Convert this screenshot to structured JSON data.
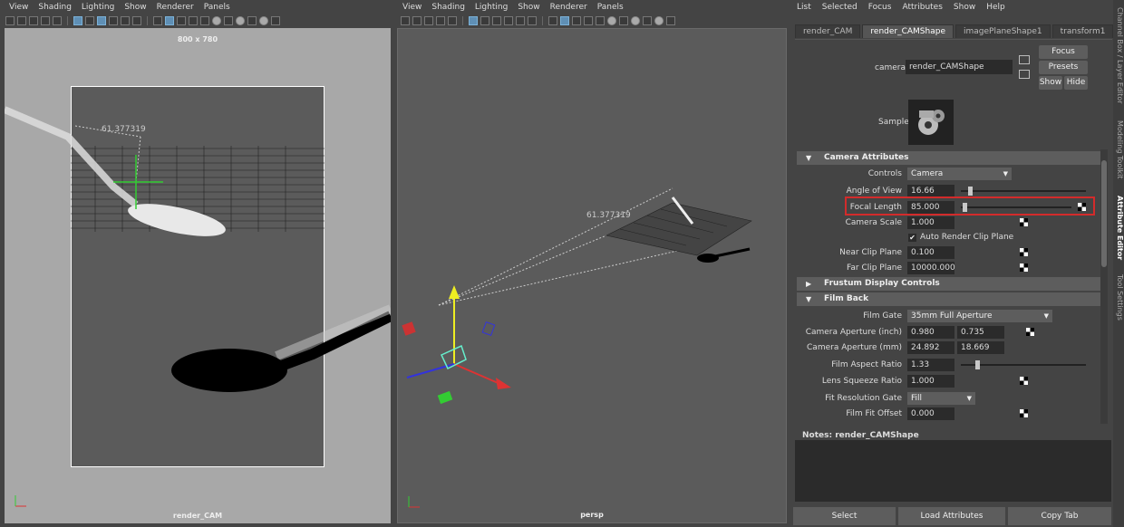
{
  "viewport_left": {
    "menu": [
      "View",
      "Shading",
      "Lighting",
      "Show",
      "Renderer",
      "Panels"
    ],
    "resolution_gate": "800 x 780",
    "distance_label": "61.377319",
    "camera_label": "render_CAM"
  },
  "viewport_right": {
    "menu": [
      "View",
      "Shading",
      "Lighting",
      "Show",
      "Renderer",
      "Panels"
    ],
    "distance_label": "61.377319",
    "camera_label": "persp"
  },
  "attribute_editor": {
    "menu": [
      "List",
      "Selected",
      "Focus",
      "Attributes",
      "Show",
      "Help"
    ],
    "tabs": [
      "render_CAM",
      "render_CAMShape",
      "imagePlaneShape1",
      "transform1"
    ],
    "active_tab": "render_CAMShape",
    "camera_label": "camera:",
    "camera_value": "render_CAMShape",
    "buttons": {
      "focus": "Focus",
      "presets": "Presets",
      "show": "Show",
      "hide": "Hide"
    },
    "sample_label": "Sample",
    "sections": {
      "camera_attributes": "Camera Attributes",
      "frustum": "Frustum Display Controls",
      "film_back": "Film Back"
    },
    "attrs": {
      "controls_label": "Controls",
      "controls_value": "Camera",
      "aov_label": "Angle of View",
      "aov_value": "16.66",
      "aov_fraction": 0.06,
      "focal_label": "Focal Length",
      "focal_value": "85.000",
      "focal_fraction": 0.02,
      "camera_scale_label": "Camera Scale",
      "camera_scale_value": "1.000",
      "auto_clip_label": "Auto Render Clip Plane",
      "near_label": "Near Clip Plane",
      "near_value": "0.100",
      "far_label": "Far Clip Plane",
      "far_value": "10000.000",
      "film_gate_label": "Film Gate",
      "film_gate_value": "35mm Full Aperture",
      "aperture_in_label": "Camera Aperture (inch)",
      "aperture_in_x": "0.980",
      "aperture_in_y": "0.735",
      "aperture_mm_label": "Camera Aperture (mm)",
      "aperture_mm_x": "24.892",
      "aperture_mm_y": "18.669",
      "film_aspect_label": "Film Aspect Ratio",
      "film_aspect_value": "1.33",
      "film_aspect_fraction": 0.12,
      "lens_squeeze_label": "Lens Squeeze Ratio",
      "lens_squeeze_value": "1.000",
      "fit_gate_label": "Fit Resolution Gate",
      "fit_gate_value": "Fill",
      "fit_offset_label": "Film Fit Offset",
      "fit_offset_value": "0.000"
    },
    "notes_label": "Notes:  render_CAMShape",
    "bottom_buttons": {
      "select": "Select",
      "load": "Load Attributes",
      "copy": "Copy Tab"
    }
  },
  "side_tabs": [
    "Channel Box / Layer Editor",
    "Modeling Toolkit",
    "Attribute Editor",
    "Tool Settings"
  ],
  "colors": {
    "highlight": "#d32b2b",
    "accent": "#5f8fb5"
  }
}
